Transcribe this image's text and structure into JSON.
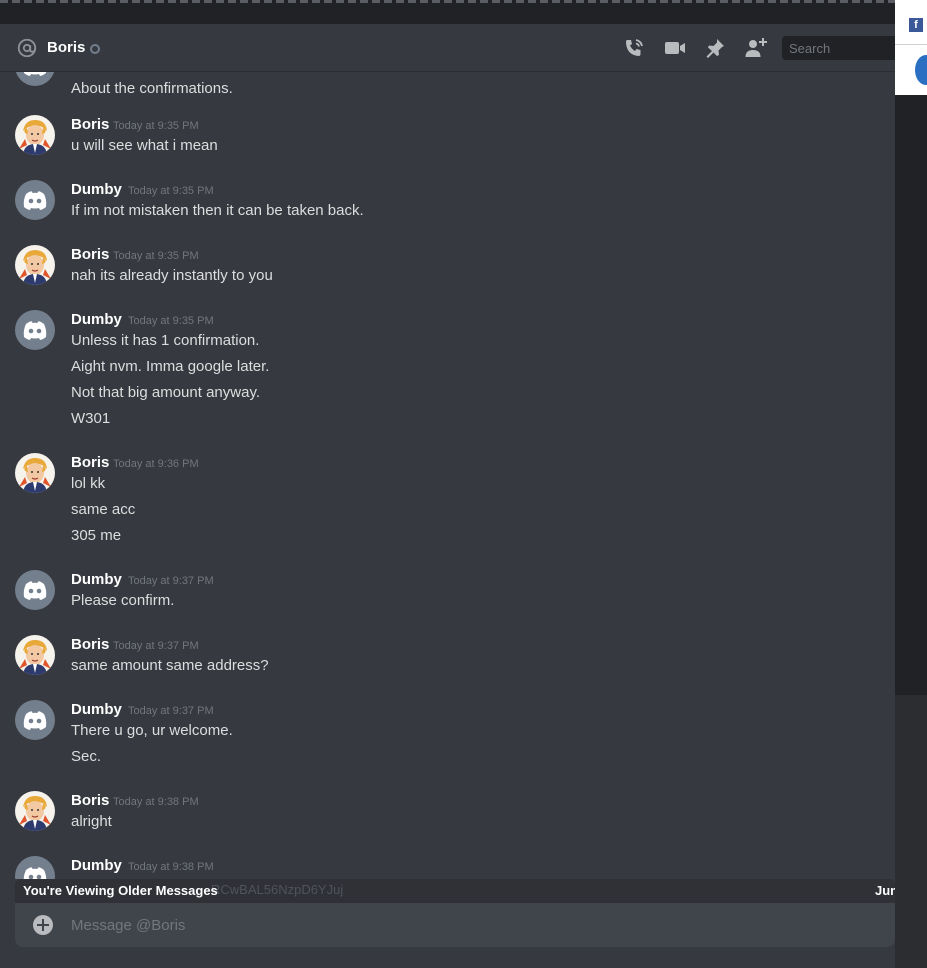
{
  "header": {
    "channel_name": "Boris",
    "search_placeholder": "Search"
  },
  "messages": [
    {
      "author": "",
      "time": "",
      "lines": [
        "About the confirmations."
      ],
      "avatar": "discord"
    },
    {
      "author": "Boris",
      "time": "Today at 9:35 PM",
      "lines": [
        "u will see what i mean"
      ],
      "avatar": "boris"
    },
    {
      "author": "Dumby",
      "time": "Today at 9:35 PM",
      "lines": [
        "If im not mistaken then it can be taken back."
      ],
      "avatar": "discord"
    },
    {
      "author": "Boris",
      "time": "Today at 9:35 PM",
      "lines": [
        "nah its already instantly to you"
      ],
      "avatar": "boris"
    },
    {
      "author": "Dumby",
      "time": "Today at 9:35 PM",
      "lines": [
        "Unless it has 1 confirmation.",
        "Aight nvm. Imma google later.",
        "Not that big amount anyway.",
        "W301"
      ],
      "avatar": "discord"
    },
    {
      "author": "Boris",
      "time": "Today at 9:36 PM",
      "lines": [
        "lol kk",
        "same acc",
        "305 me"
      ],
      "avatar": "boris"
    },
    {
      "author": "Dumby",
      "time": "Today at 9:37 PM",
      "lines": [
        "Please confirm."
      ],
      "avatar": "discord"
    },
    {
      "author": "Boris",
      "time": "Today at 9:37 PM",
      "lines": [
        "same amount same address?"
      ],
      "avatar": "boris"
    },
    {
      "author": "Dumby",
      "time": "Today at 9:37 PM",
      "lines": [
        "There u go, ur welcome.",
        "Sec."
      ],
      "avatar": "discord"
    },
    {
      "author": "Boris",
      "time": "Today at 9:38 PM",
      "lines": [
        "alright"
      ],
      "avatar": "boris"
    },
    {
      "author": "Dumby",
      "time": "Today at 9:38 PM",
      "lines": [],
      "avatar": "discord"
    }
  ],
  "older_bar": {
    "label": "You're Viewing Older Messages",
    "ghost_text": "RCwBAL56NzpD6YJuj",
    "jump_label": "Jum"
  },
  "composer": {
    "placeholder": "Message @Boris"
  },
  "colors": {
    "background": "#36393f",
    "discord_avatar": "#747f8d",
    "text": "#dcddde",
    "muted": "#72767d"
  }
}
